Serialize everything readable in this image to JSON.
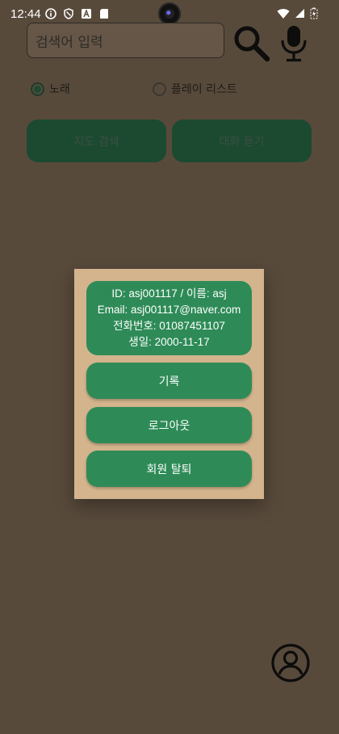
{
  "status_bar": {
    "time": "12:44",
    "left_icons": [
      "info-icon",
      "shield-icon",
      "font-icon",
      "sd-card-icon"
    ],
    "right_icons": [
      "wifi-icon",
      "signal-icon",
      "battery-charging-icon"
    ]
  },
  "search": {
    "placeholder": "검색어 입력"
  },
  "radio_options": [
    {
      "label": "노래",
      "selected": true
    },
    {
      "label": "플레이 리스트",
      "selected": false
    }
  ],
  "buttons": {
    "map_search": "지도 검색",
    "listen_conversation": "대화 듣기"
  },
  "dialog": {
    "user_info": {
      "line1": "ID: asj001117 / 이름: asj",
      "line2": "Email: asj001117@naver.com",
      "line3": "전화번호: 01087451107",
      "line4": "생일: 2000-11-17"
    },
    "history": "기록",
    "logout": "로그아웃",
    "withdraw": "회원 탈퇴"
  },
  "colors": {
    "background_dimmed": "#584a3b",
    "dialog_bg": "#d4b48d",
    "accent_green": "#2e8b57",
    "button_green_dimmed": "#1b4a31"
  }
}
